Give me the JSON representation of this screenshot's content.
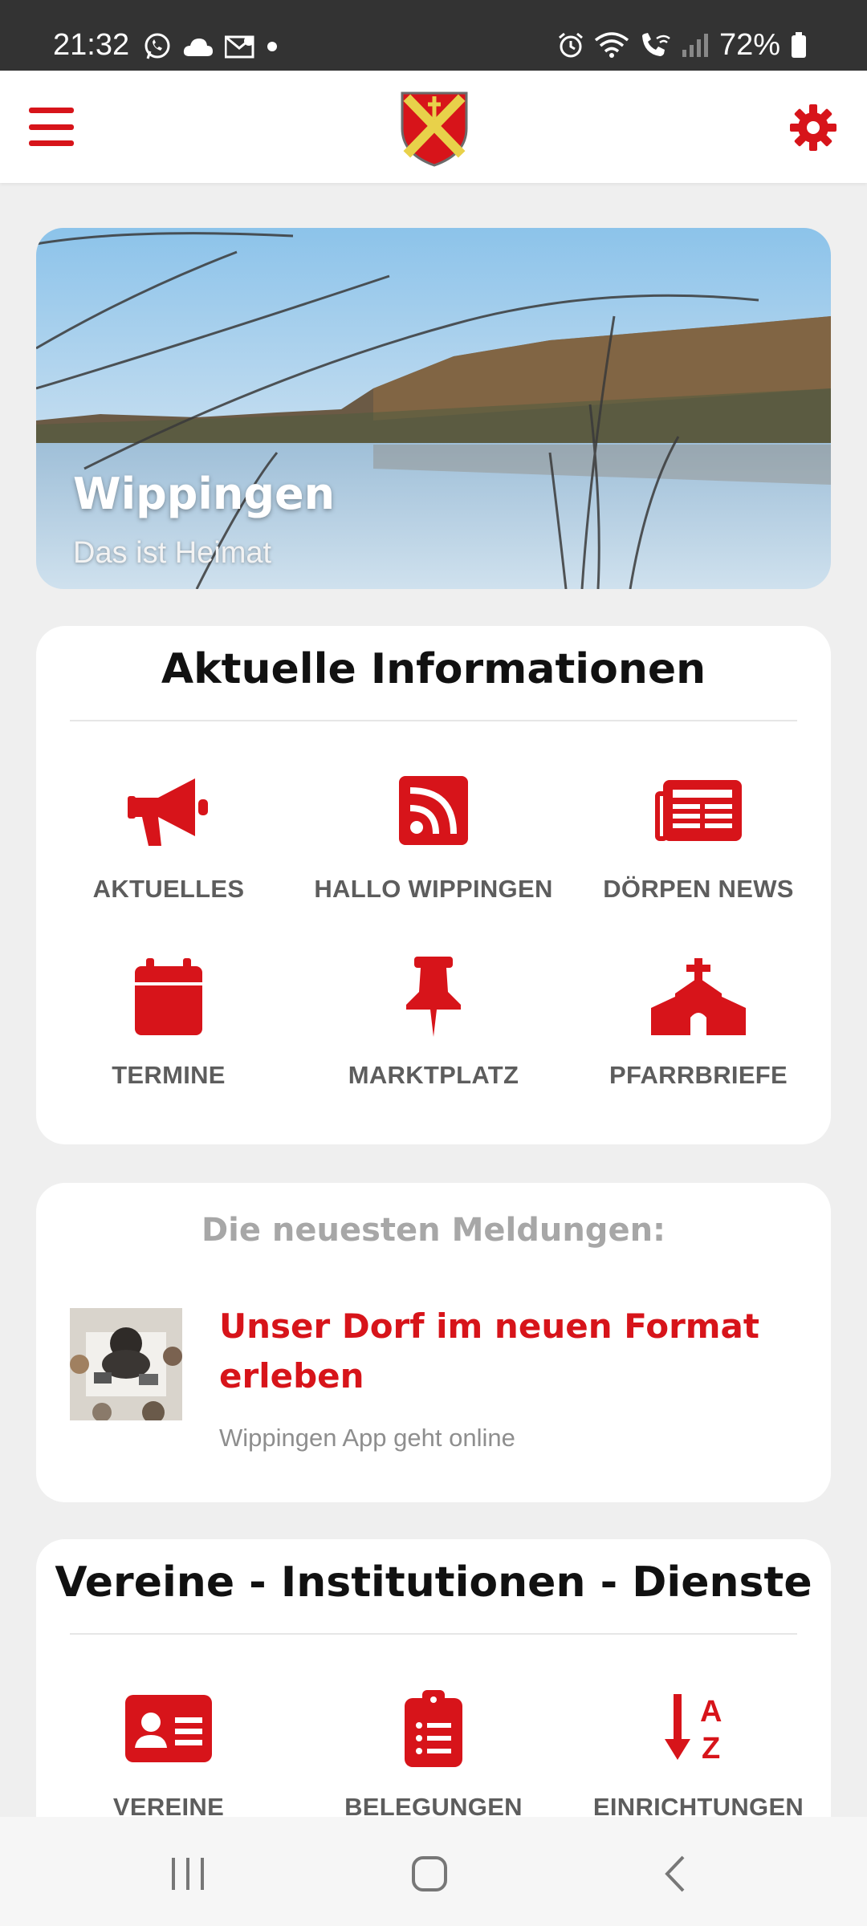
{
  "status_bar": {
    "time": "21:32",
    "battery_text": "72%",
    "left_icons": [
      "whatsapp-icon",
      "cloud-icon",
      "mail-icon",
      "dot-icon"
    ],
    "right_icons": [
      "alarm-icon",
      "wifi-icon",
      "wifi-call-icon",
      "signal-icon",
      "battery-icon"
    ]
  },
  "header": {
    "menu_icon": "hamburger-menu-icon",
    "logo": "municipal-crest-logo",
    "settings_icon": "gear-icon"
  },
  "hero": {
    "title": "Wippingen",
    "subtitle": "Das ist Heimat"
  },
  "info_section": {
    "title": "Aktuelle Informationen",
    "items": [
      {
        "label": "AKTUELLES",
        "icon": "megaphone-icon"
      },
      {
        "label": "HALLO WIPPINGEN",
        "icon": "rss-feed-icon"
      },
      {
        "label": "DÖRPEN NEWS",
        "icon": "newspaper-icon"
      },
      {
        "label": "TERMINE",
        "icon": "calendar-icon"
      },
      {
        "label": "MARKTPLATZ",
        "icon": "pushpin-icon"
      },
      {
        "label": "PFARRBRIEFE",
        "icon": "church-icon"
      }
    ]
  },
  "news_section": {
    "heading": "Die neuesten Meldungen:",
    "article": {
      "title": "Unser Dorf im neuen Format erleben",
      "subtitle": "Wippingen App geht online"
    }
  },
  "org_section": {
    "title": "Vereine - Institutionen - Dienste",
    "items": [
      {
        "label": "VEREINE",
        "icon": "id-card-icon"
      },
      {
        "label": "BELEGUNGEN",
        "icon": "clipboard-list-icon"
      },
      {
        "label": "EINRICHTUNGEN",
        "icon": "sort-a-z-icon"
      }
    ]
  },
  "nav_bar": {
    "buttons": [
      "recent-apps-icon",
      "home-icon",
      "back-icon"
    ]
  },
  "colors": {
    "accent": "#d7141a",
    "label_gray": "#5d5d5d",
    "status_bar": "#333333",
    "background": "#efefef"
  }
}
